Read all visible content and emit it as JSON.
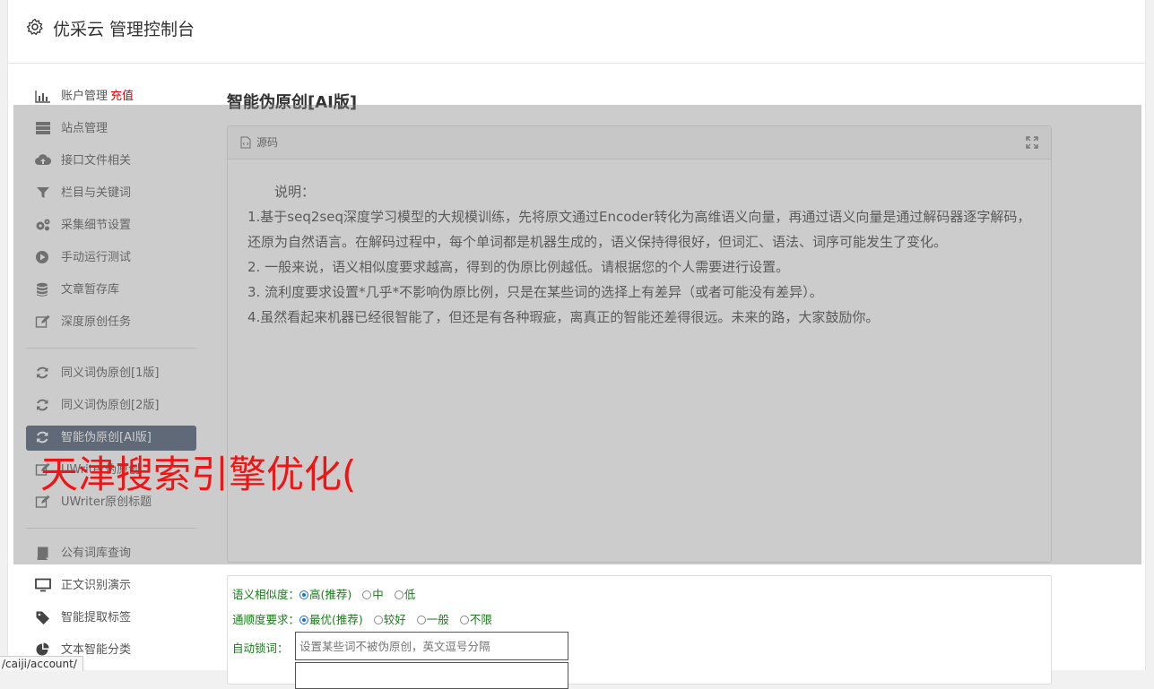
{
  "header": {
    "title": "优采云 管理控制台"
  },
  "sidebar": {
    "group1": [
      {
        "icon": "bar-chart-icon",
        "label": "账户管理",
        "badge": "充值"
      },
      {
        "icon": "server-icon",
        "label": "站点管理"
      },
      {
        "icon": "cloud-upload-icon",
        "label": "接口文件相关"
      },
      {
        "icon": "filter-icon",
        "label": "栏目与关键词"
      },
      {
        "icon": "cogs-icon",
        "label": "采集细节设置"
      },
      {
        "icon": "play-circle-icon",
        "label": "手动运行测试"
      },
      {
        "icon": "database-icon",
        "label": "文章暂存库"
      },
      {
        "icon": "edit-icon",
        "label": "深度原创任务"
      }
    ],
    "group2": [
      {
        "icon": "refresh-icon",
        "label": "同义词伪原创[1版]"
      },
      {
        "icon": "refresh-icon",
        "label": "同义词伪原创[2版]"
      },
      {
        "icon": "refresh-icon",
        "label": "智能伪原创[AI版]",
        "active": true
      },
      {
        "icon": "edit-icon",
        "label": "UWriter伪原创"
      },
      {
        "icon": "edit-icon",
        "label": "UWriter原创标题"
      }
    ],
    "group3": [
      {
        "icon": "book-icon",
        "label": "公有词库查询"
      },
      {
        "icon": "desktop-icon",
        "label": "正文识别演示"
      },
      {
        "icon": "tag-icon",
        "label": "智能提取标签"
      },
      {
        "icon": "pie-chart-icon",
        "label": "文本智能分类"
      }
    ]
  },
  "main": {
    "heading": "智能伪原创[AI版]",
    "source_panel": {
      "title": "源码",
      "lines": [
        "说明：",
        "1.基于seq2seq深度学习模型的大规模训练，先将原文通过Encoder转化为高维语义向量，再通过语义向量是通过解码器逐字解码，还原为自然语言。在解码过程中，每个单词都是机器生成的，语义保持得很好，但词汇、语法、词序可能发生了变化。",
        "2. 一般来说，语义相似度要求越高，得到的伪原比例越低。请根据您的个人需要进行设置。",
        "3. 流利度要求设置*几乎*不影响伪原比例，只是在某些词的选择上有差异（或者可能没有差异）。",
        "4.虽然看起来机器已经很智能了，但还是有各种瑕疵，离真正的智能还差得很远。未来的路，大家鼓励你。"
      ]
    },
    "form": {
      "similarity": {
        "label": "语义相似度：",
        "options": [
          "高(推荐)",
          "中",
          "低"
        ],
        "selected": 0
      },
      "fluency": {
        "label": "通顺度要求：",
        "options": [
          "最优(推荐)",
          "较好",
          "一般",
          "不限"
        ],
        "selected": 0
      },
      "lock_words": {
        "label": "自动锁词：",
        "placeholder": "设置某些词不被伪原创，英文逗号分隔"
      }
    }
  },
  "watermark": "天津搜索引擎优化(",
  "statusbar": {
    "url": "/caiji/account/"
  },
  "colors": {
    "badge": "#e60000",
    "active_nav": "#4a5a73",
    "form_label": "#1a7a1a",
    "watermark": "#f01515"
  }
}
